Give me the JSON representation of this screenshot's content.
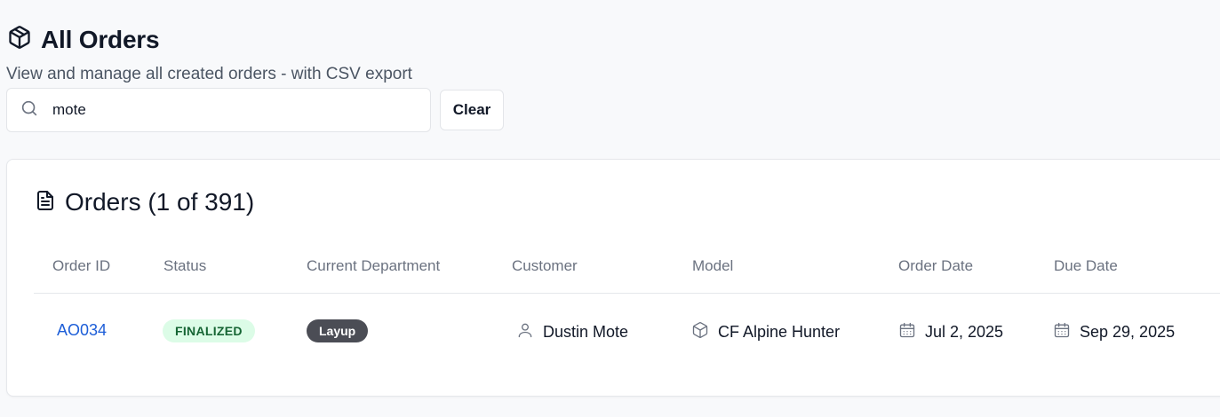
{
  "header": {
    "title": "All Orders",
    "subtitle": "View and manage all created orders - with CSV export",
    "title_icon": "package-icon"
  },
  "search": {
    "value": "mote",
    "placeholder": "",
    "icon": "search-icon",
    "clear_label": "Clear"
  },
  "orders_card": {
    "title": "Orders (1 of 391)",
    "icon": "document-icon",
    "columns": [
      "Order ID",
      "Status",
      "Current Department",
      "Customer",
      "Model",
      "Order Date",
      "Due Date"
    ],
    "rows": [
      {
        "order_id": "AO034",
        "status": "FINALIZED",
        "department": "Layup",
        "customer": "Dustin Mote",
        "model": "CF Alpine Hunter",
        "order_date": "Jul 2, 2025",
        "due_date": "Sep 29, 2025"
      }
    ]
  },
  "colors": {
    "link": "#1d5ed8",
    "status_bg": "#dcfce7",
    "status_text": "#166534",
    "dept_bg": "#4b4d55"
  }
}
